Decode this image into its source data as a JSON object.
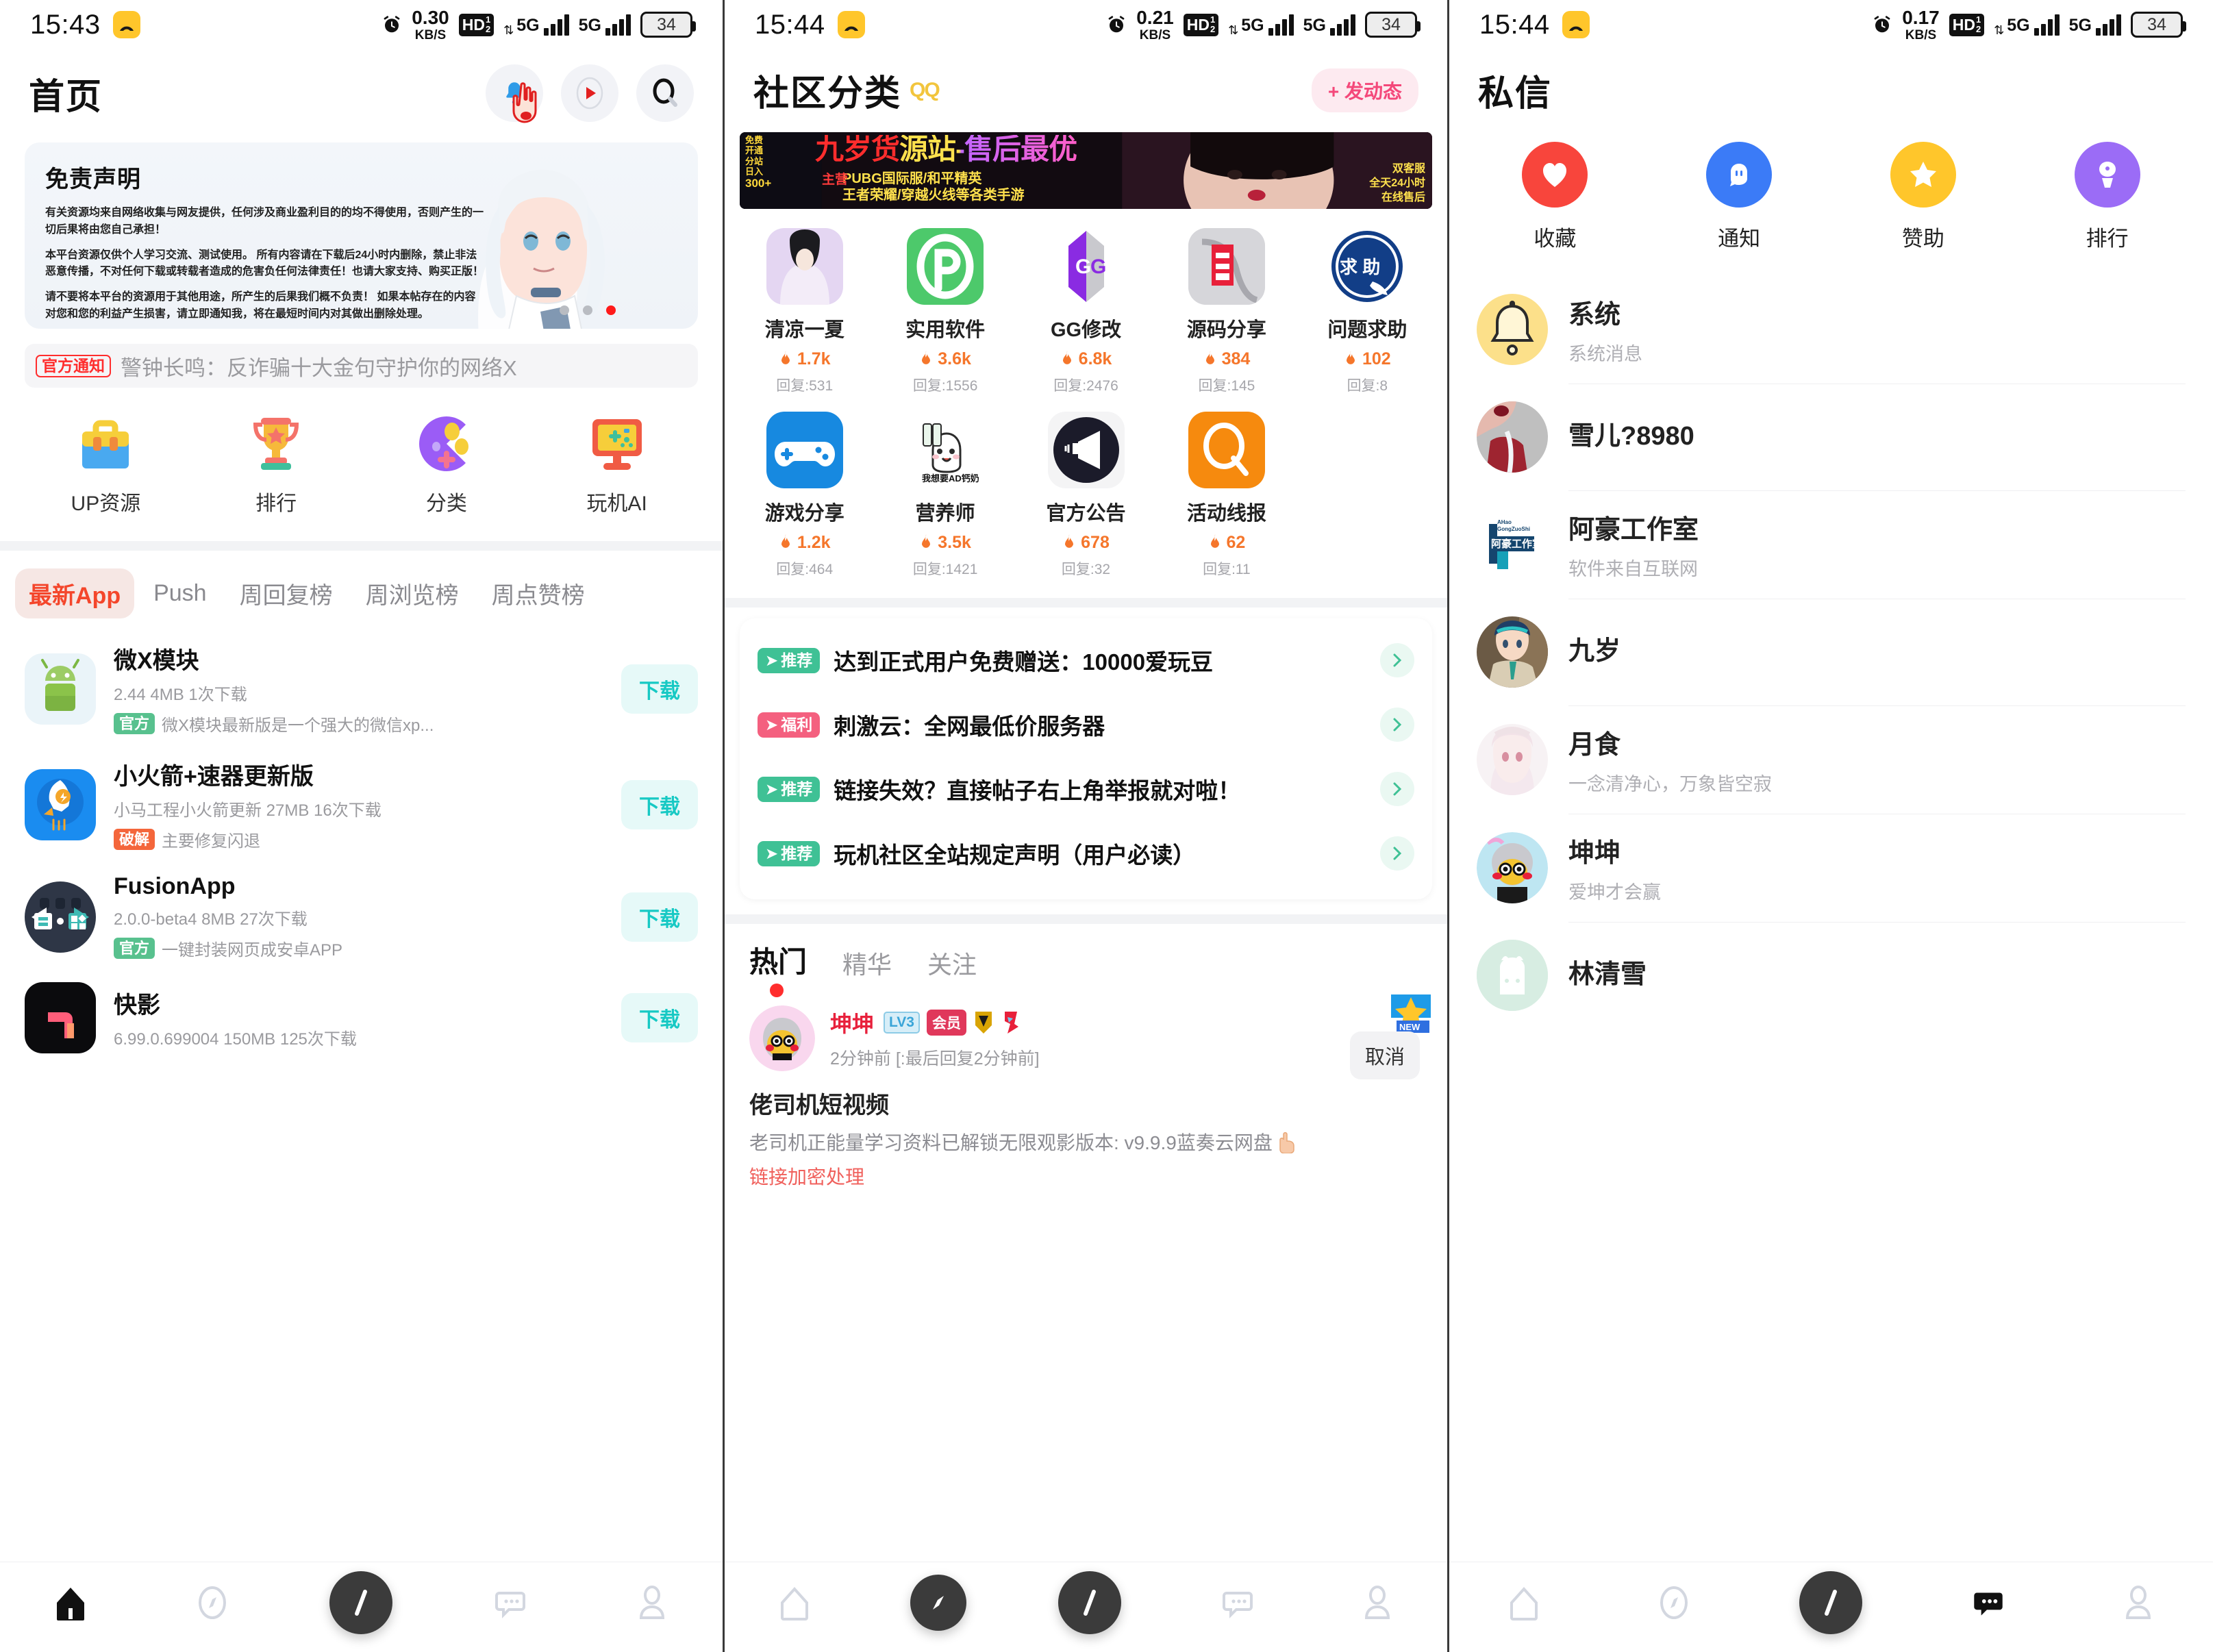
{
  "status_bars": [
    {
      "time": "15:43",
      "speed": "0.30",
      "speed_unit": "KB/S",
      "hd": "HD",
      "hd_sub1": "1",
      "hd_sub2": "2",
      "net1": "5G",
      "net2": "5G",
      "battery": "34"
    },
    {
      "time": "15:44",
      "speed": "0.21",
      "speed_unit": "KB/S",
      "hd": "HD",
      "hd_sub1": "1",
      "hd_sub2": "2",
      "net1": "5G",
      "net2": "5G",
      "battery": "34"
    },
    {
      "time": "15:44",
      "speed": "0.17",
      "speed_unit": "KB/S",
      "hd": "HD",
      "hd_sub1": "1",
      "hd_sub2": "2",
      "net1": "5G",
      "net2": "5G",
      "battery": "34"
    }
  ],
  "screen1": {
    "title": "首页",
    "actions": [
      {
        "name": "notification-bell-icon",
        "label": "通知"
      },
      {
        "name": "video-play-icon",
        "label": "视频"
      },
      {
        "name": "search-icon",
        "label": "搜索"
      }
    ],
    "disclaimer": {
      "title": "免责声明",
      "p1": "有关资源均来自网络收集与网友提供，任何涉及商业盈利目的的均不得使用，否则产生的一切后果将由您自己承担！",
      "p2": "本平台资源仅供个人学习交流、测试使用。 所有内容请在下载后24小时内删除，禁止非法恶意传播，不对任何下载或转载者造成的危害负任何法律责任！也请大家支持、购买正版！",
      "p3": "请不要将本平台的资源用于其他用途，所产生的后果我们概不负责！ 如果本帖存在的内容对您和您的利益产生损害，请立即通知我，将在最短时间内对其做出删除处理。"
    },
    "notice": {
      "tag": "官方通知",
      "text": "警钟长鸣：反诈骗十大金句守护你的网络X"
    },
    "quick_actions": [
      {
        "label": "UP资源",
        "icon": "toolbox-icon"
      },
      {
        "label": "排行",
        "icon": "trophy-icon"
      },
      {
        "label": "分类",
        "icon": "category-icon"
      },
      {
        "label": "玩机AI",
        "icon": "monitor-ai-icon"
      }
    ],
    "tabs": [
      "最新App",
      "Push",
      "周回复榜",
      "周浏览榜",
      "周点赞榜"
    ],
    "active_tab": "最新App",
    "apps": [
      {
        "name": "微X模块",
        "meta": "2.44 4MB 1次下载",
        "badge": "官方",
        "badge_type": "official",
        "desc": "微X模块最新版是一个强大的微信xp...",
        "button": "下载",
        "icon": "android-robot-icon"
      },
      {
        "name": "小火箭+速器更新版",
        "meta": "小马工程小火箭更新 27MB 16次下载",
        "badge": "破解",
        "badge_type": "crack",
        "desc": "主要修复闪退",
        "button": "下载",
        "icon": "rocket-icon"
      },
      {
        "name": "FusionApp",
        "meta": "2.0.0-beta4 8MB 27次下载",
        "badge": "官方",
        "badge_type": "official",
        "desc": "一键封装网页成安卓APP",
        "button": "下载",
        "icon": "fusion-icon"
      },
      {
        "name": "快影",
        "meta": "6.99.0.699004 150MB 125次下载",
        "badge": "",
        "badge_type": "",
        "desc": "",
        "button": "下载",
        "icon": "kuaiying-icon"
      }
    ],
    "bottom_nav": [
      {
        "name": "home",
        "active": true
      },
      {
        "name": "compass",
        "active": false
      },
      {
        "name": "center-slash",
        "active": false
      },
      {
        "name": "message",
        "active": false
      },
      {
        "name": "profile",
        "active": false
      }
    ]
  },
  "screen2": {
    "title": "社区分类",
    "title_suffix": "QQ",
    "post_button": "+ 发动态",
    "banner": {
      "side_lines": [
        "免费",
        "开通",
        "分站",
        "日入",
        "300+"
      ],
      "main": "九岁货源站-售后最优",
      "label_main": "主营",
      "sub1": "PUBG国际服/和平精英",
      "sub2": "王者荣耀/穿越火线等各类手游",
      "right": [
        "双客服",
        "全天24小时",
        "在线售后"
      ]
    },
    "categories": [
      {
        "name": "清凉一夏",
        "hot": "1.7k",
        "reply": "回复:531",
        "icon": "girl-photo-icon"
      },
      {
        "name": "实用软件",
        "hot": "3.6k",
        "reply": "回复:1556",
        "icon": "green-p-icon"
      },
      {
        "name": "GG修改",
        "hot": "6.8k",
        "reply": "回复:2476",
        "icon": "gg-icon"
      },
      {
        "name": "源码分享",
        "hot": "384",
        "reply": "回复:145",
        "icon": "yi-source-icon"
      },
      {
        "name": "问题求助",
        "hot": "102",
        "reply": "回复:8",
        "icon": "help-icon"
      },
      {
        "name": "游戏分享",
        "hot": "1.2k",
        "reply": "回复:464",
        "icon": "gamepad-icon"
      },
      {
        "name": "营养师",
        "hot": "3.5k",
        "reply": "回复:1421",
        "icon": "ad-milk-icon",
        "icon_caption": "我想要AD钙奶"
      },
      {
        "name": "官方公告",
        "hot": "678",
        "reply": "回复:32",
        "icon": "megaphone-icon"
      },
      {
        "name": "活动线报",
        "hot": "62",
        "reply": "回复:11",
        "icon": "orange-q-icon"
      }
    ],
    "announcements": [
      {
        "tag": "推荐",
        "tag_type": "rec",
        "title": "达到正式用户免费赠送：10000爱玩豆"
      },
      {
        "tag": "福利",
        "tag_type": "fuli",
        "title": "刺激云：全网最低价服务器"
      },
      {
        "tag": "推荐",
        "tag_type": "rec",
        "title": "链接失效？直接帖子右上角举报就对啦！"
      },
      {
        "tag": "推荐",
        "tag_type": "rec",
        "title": "玩机社区全站规定声明（用户必读）"
      }
    ],
    "subtabs": [
      "热门",
      "精华",
      "关注"
    ],
    "active_subtab": "热门",
    "post": {
      "author": "坤坤",
      "level": "LV3",
      "vip": "会员",
      "time": "2分钟前 [:最后回复2分钟前]",
      "cancel": "取消",
      "new_flag": "NEW",
      "title": "佬司机短视频",
      "body": "老司机正能量学习资料已解锁无限观影版本: v9.9.9蓝奏云网盘",
      "link": "链接加密处理"
    },
    "bottom_nav": [
      {
        "name": "home",
        "active": false
      },
      {
        "name": "compass",
        "active": true
      },
      {
        "name": "center-slash",
        "active": false
      },
      {
        "name": "message",
        "active": false
      },
      {
        "name": "profile",
        "active": false
      }
    ]
  },
  "screen3": {
    "title": "私信",
    "quick_actions": [
      {
        "label": "收藏",
        "icon": "heart-icon",
        "color": "#F8453C"
      },
      {
        "label": "通知",
        "icon": "bell-chat-icon",
        "color": "#3B7BF7"
      },
      {
        "label": "赞助",
        "icon": "star-icon",
        "color": "#FFC62B"
      },
      {
        "label": "排行",
        "icon": "medal-icon",
        "color": "#9B6CF6"
      }
    ],
    "messages": [
      {
        "name": "系统",
        "sub": "系统消息",
        "avatar": "system-bell-avatar"
      },
      {
        "name": "雪儿?8980",
        "sub": "",
        "avatar": "xueer-avatar"
      },
      {
        "name": "阿豪工作室",
        "sub": "软件来自互联网",
        "avatar": "ahao-studio-avatar"
      },
      {
        "name": "九岁",
        "sub": "",
        "avatar": "jiusui-avatar"
      },
      {
        "name": "月食",
        "sub": "一念清净心，万象皆空寂",
        "avatar": "yueshi-avatar"
      },
      {
        "name": "坤坤",
        "sub": "爱坤才会赢",
        "avatar": "kunkun-avatar"
      },
      {
        "name": "林清雪",
        "sub": "",
        "avatar": "linqingxue-avatar"
      }
    ],
    "bottom_nav": [
      {
        "name": "home",
        "active": false
      },
      {
        "name": "compass",
        "active": false
      },
      {
        "name": "center-slash",
        "active": false
      },
      {
        "name": "message",
        "active": true
      },
      {
        "name": "profile",
        "active": false
      }
    ]
  },
  "colors": {
    "accent_red": "#F4462B",
    "download_teal": "#17C9C4",
    "hot_orange": "#F5762B",
    "rec_green": "#3FC195",
    "fuli_pink": "#F4607F"
  }
}
